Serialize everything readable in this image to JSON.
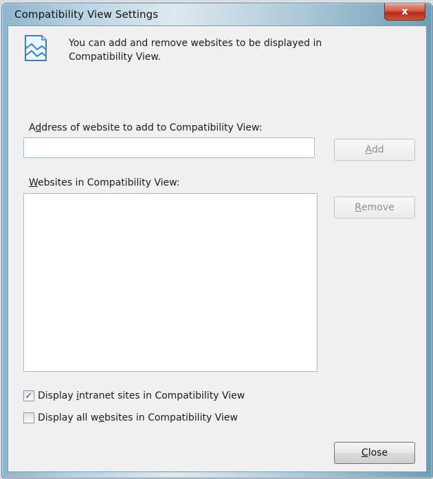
{
  "window": {
    "title": "Compatibility View Settings",
    "close_glyph": "x"
  },
  "intro": {
    "icon": "compatibility-view-icon",
    "text": "You can add and remove websites to be displayed in Compatibility View."
  },
  "add_section": {
    "label_pre": "A",
    "label_key": "d",
    "label_post": "dress of website to add to Compatibility View:",
    "input_value": "",
    "add_key": "A",
    "add_rest": "dd"
  },
  "list_section": {
    "label_key": "W",
    "label_post": "ebsites in Compatibility View:",
    "items": [],
    "remove_key": "R",
    "remove_rest": "emove"
  },
  "options": {
    "intranet": {
      "checked": true,
      "check_glyph": "✓",
      "pre": "Display ",
      "key": "i",
      "post": "ntranet sites in Compatibility View"
    },
    "all": {
      "checked": false,
      "check_glyph": "",
      "pre": "Display all w",
      "key": "e",
      "post": "bsites in Compatibility View"
    }
  },
  "footer": {
    "close_key": "C",
    "close_rest": "lose"
  },
  "colors": {
    "titlebar_close": "#c9553c",
    "client_bg": "#f0f0f0",
    "input_border": "#9fc0dc",
    "disabled_text": "#8d8d8d"
  }
}
